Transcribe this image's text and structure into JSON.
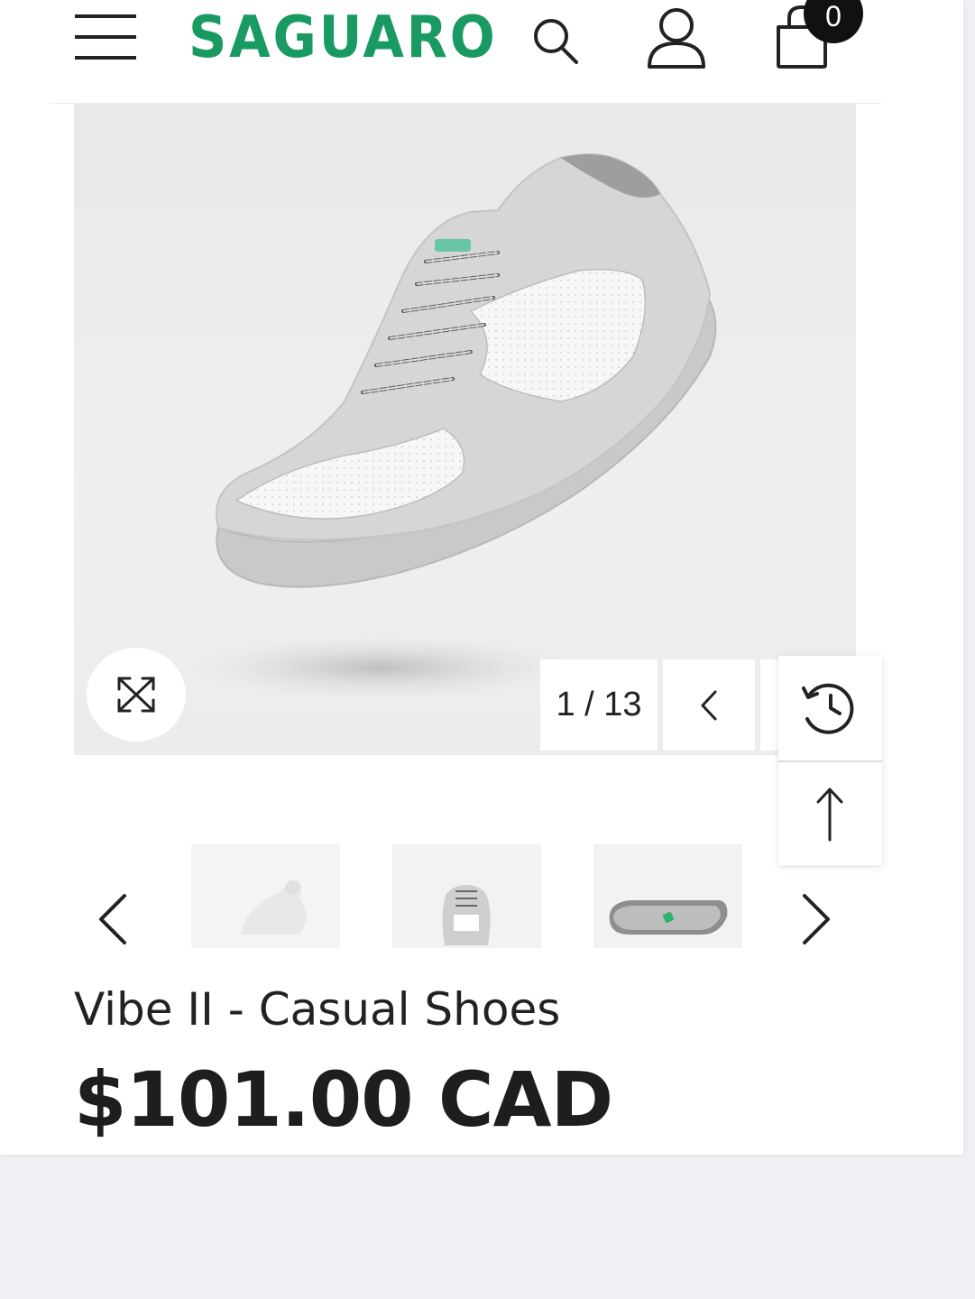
{
  "header": {
    "logo_text": "SAGUARO",
    "cart_count": "0",
    "brand_color": "#1a9a63"
  },
  "gallery": {
    "counter": "1 / 13",
    "current_image": 1,
    "total_images": 13
  },
  "icons": {
    "menu": "hamburger-icon",
    "search": "search-icon",
    "account": "user-icon",
    "cart": "shopping-bag-icon",
    "zoom": "expand-icon",
    "prev": "chevron-left-icon",
    "next": "chevron-right-icon",
    "history": "history-clock-icon",
    "back_to_top": "arrow-up-icon"
  },
  "product": {
    "title": "Vibe II - Casual Shoes",
    "price": "$101.00 CAD"
  }
}
